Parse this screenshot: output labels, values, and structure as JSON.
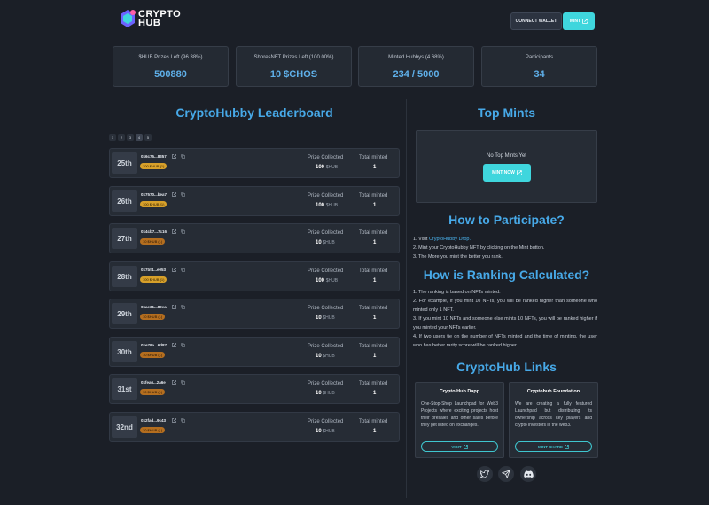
{
  "header": {
    "logo_line1": "CRYPTO",
    "logo_line2": "HUB",
    "connect_label": "CONNECT WALLET",
    "mint_label": "MINT"
  },
  "stats": [
    {
      "label": "$HUB Prizes Left (96.38%)",
      "value": "500880"
    },
    {
      "label": "ShoresNFT Prizes Left (100.00%)",
      "value": "10 $CHOS"
    },
    {
      "label": "Minted Hubbys (4.68%)",
      "value": "234 / 5000"
    },
    {
      "label": "Participants",
      "value": "34"
    }
  ],
  "leaderboard": {
    "title": "CryptoHubby Leaderboard",
    "pages": [
      "1",
      "2",
      "3",
      "4",
      "5"
    ],
    "active_page": "4",
    "prize_header": "Prize Collected",
    "minted_header": "Total minted",
    "rows": [
      {
        "rank": "25th",
        "address": "0x6c75...8357",
        "badge": "100 $HUB (1)",
        "tier": "gold",
        "prize": "100",
        "unit": "$HUB",
        "minted": "1"
      },
      {
        "rank": "26th",
        "address": "0x7570...bea7",
        "badge": "100 $HUB (1)",
        "tier": "gold",
        "prize": "100",
        "unit": "$HUB",
        "minted": "1"
      },
      {
        "rank": "27th",
        "address": "0x4cb7...7c16",
        "badge": "10 $HUB (1)",
        "tier": "bronze",
        "prize": "10",
        "unit": "$HUB",
        "minted": "1"
      },
      {
        "rank": "28th",
        "address": "0x7bf4...e053",
        "badge": "100 $HUB (1)",
        "tier": "gold",
        "prize": "100",
        "unit": "$HUB",
        "minted": "1"
      },
      {
        "rank": "29th",
        "address": "0xae31...89ea",
        "badge": "10 $HUB (1)",
        "tier": "bronze",
        "prize": "10",
        "unit": "$HUB",
        "minted": "1"
      },
      {
        "rank": "30th",
        "address": "0xe79a...6d87",
        "badge": "10 $HUB (1)",
        "tier": "bronze",
        "prize": "10",
        "unit": "$HUB",
        "minted": "1"
      },
      {
        "rank": "31st",
        "address": "0xfea6...2a6e",
        "badge": "10 $HUB (1)",
        "tier": "bronze",
        "prize": "10",
        "unit": "$HUB",
        "minted": "1"
      },
      {
        "rank": "32nd",
        "address": "0x2fad...9c43",
        "badge": "10 $HUB (1)",
        "tier": "bronze",
        "prize": "10",
        "unit": "$HUB",
        "minted": "1"
      }
    ]
  },
  "top_mints": {
    "title": "Top Mints",
    "empty_text": "No Top Mints Yet",
    "button_label": "MINT NOW"
  },
  "participate": {
    "title": "How to Participate?",
    "step1_prefix": "1. Visit ",
    "step1_link": "CryptoHubby Drop.",
    "step2": "2. Mint your CryptoHubby NFT by clicking on the Mint button.",
    "step3": "3. The More you mint the better you rank."
  },
  "ranking": {
    "title": "How is Ranking Calculated?",
    "lines": [
      "1. The ranking is based on NFTs minted.",
      "2. For example, If you mint 10 NFTs, you will be ranked higher than someone who minted only 1 NFT.",
      "3. If you mint 10 NFTs and someone else mints 10 NFTs, you will be ranked higher if you minted your NFTs earlier.",
      "4. If two users tie on the number of NFTs minted and the time of minting, the user who has better rarity score will be ranked higher."
    ]
  },
  "links": {
    "title": "CryptoHub Links",
    "cards": [
      {
        "title": "Crypto Hub Dapp",
        "desc": "One-Stop-Shop Launchpad for Web3 Projects where exciting projects host their presales and other sales before they get listed on exchanges.",
        "button": "VISIT"
      },
      {
        "title": "Cryptohub Foundation",
        "desc": "We are creating a fully featured Launchpad but distributing its ownership across key players and crypto investors in the web3.",
        "button": "MINT SHARE"
      }
    ]
  },
  "social_icons": [
    "twitter-icon",
    "telegram-icon",
    "discord-icon"
  ],
  "colors": {
    "accent": "#3fd6dd",
    "title_blue": "#47a9e8",
    "gold": "#d7a02a",
    "bronze": "#b46e1f"
  }
}
